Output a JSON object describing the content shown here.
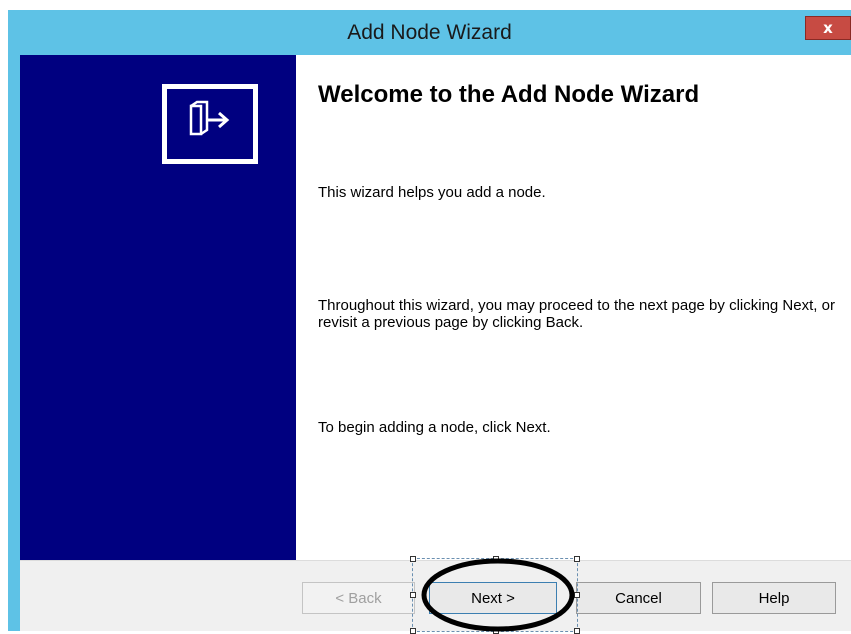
{
  "window": {
    "title": "Add Node Wizard",
    "close_label": "x"
  },
  "wizard": {
    "heading": "Welcome to the Add Node Wizard",
    "paragraphs": [
      "This wizard helps you add a node.",
      "Throughout this wizard, you may proceed to the next page by clicking Next, or revisit a previous page by clicking Back.",
      "To begin adding a node, click Next."
    ],
    "icon": "node-wizard-icon"
  },
  "buttons": {
    "back": "< Back",
    "next": "Next >",
    "cancel": "Cancel",
    "help": "Help"
  },
  "colors": {
    "titlebar": "#5ec2e6",
    "side_panel": "#000080",
    "close_button": "#c74b43"
  }
}
